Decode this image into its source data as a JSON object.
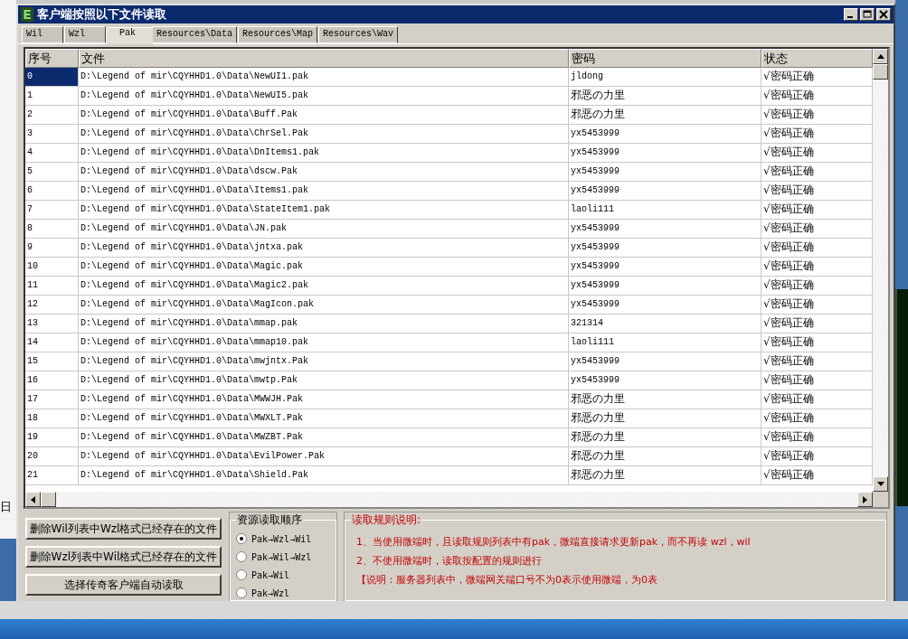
{
  "background": {
    "text": "日"
  },
  "window": {
    "icon_letter": "E",
    "title": "客户端按照以下文件读取"
  },
  "tabs": [
    {
      "label": "Wil",
      "selected": false
    },
    {
      "label": "Wzl",
      "selected": false
    },
    {
      "label": "Pak",
      "selected": true
    },
    {
      "label": "Resources\\Data",
      "selected": false
    },
    {
      "label": "Resources\\Map",
      "selected": false
    },
    {
      "label": "Resources\\Wav",
      "selected": false
    }
  ],
  "table": {
    "columns": [
      "序号",
      "文件",
      "密码",
      "状态"
    ],
    "rows": [
      {
        "cells": [
          "0",
          "D:\\Legend of mir\\CQYHHD1.0\\Data\\NewUI1.pak",
          "jldong",
          "√密码正确"
        ],
        "selected": true
      },
      {
        "cells": [
          "1",
          "D:\\Legend of mir\\CQYHHD1.0\\Data\\NewUI5.pak",
          "邪恶の力里",
          "√密码正确"
        ],
        "selected": false
      },
      {
        "cells": [
          "2",
          "D:\\Legend of mir\\CQYHHD1.0\\Data\\Buff.Pak",
          "邪恶の力里",
          "√密码正确"
        ],
        "selected": false
      },
      {
        "cells": [
          "3",
          "D:\\Legend of mir\\CQYHHD1.0\\Data\\ChrSel.Pak",
          "yx5453999",
          "√密码正确"
        ],
        "selected": false
      },
      {
        "cells": [
          "4",
          "D:\\Legend of mir\\CQYHHD1.0\\Data\\DnItems1.pak",
          "yx5453999",
          "√密码正确"
        ],
        "selected": false
      },
      {
        "cells": [
          "5",
          "D:\\Legend of mir\\CQYHHD1.0\\Data\\dscw.Pak",
          "yx5453999",
          "√密码正确"
        ],
        "selected": false
      },
      {
        "cells": [
          "6",
          "D:\\Legend of mir\\CQYHHD1.0\\Data\\Items1.pak",
          "yx5453999",
          "√密码正确"
        ],
        "selected": false
      },
      {
        "cells": [
          "7",
          "D:\\Legend of mir\\CQYHHD1.0\\Data\\StateItem1.pak",
          "laoli111",
          "√密码正确"
        ],
        "selected": false
      },
      {
        "cells": [
          "8",
          "D:\\Legend of mir\\CQYHHD1.0\\Data\\JN.pak",
          "yx5453999",
          "√密码正确"
        ],
        "selected": false
      },
      {
        "cells": [
          "9",
          "D:\\Legend of mir\\CQYHHD1.0\\Data\\jntxa.pak",
          "yx5453999",
          "√密码正确"
        ],
        "selected": false
      },
      {
        "cells": [
          "10",
          "D:\\Legend of mir\\CQYHHD1.0\\Data\\Magic.pak",
          "yx5453999",
          "√密码正确"
        ],
        "selected": false
      },
      {
        "cells": [
          "11",
          "D:\\Legend of mir\\CQYHHD1.0\\Data\\Magic2.pak",
          "yx5453999",
          "√密码正确"
        ],
        "selected": false
      },
      {
        "cells": [
          "12",
          "D:\\Legend of mir\\CQYHHD1.0\\Data\\MagIcon.pak",
          "yx5453999",
          "√密码正确"
        ],
        "selected": false
      },
      {
        "cells": [
          "13",
          "D:\\Legend of mir\\CQYHHD1.0\\Data\\mmap.pak",
          "321314",
          "√密码正确"
        ],
        "selected": false
      },
      {
        "cells": [
          "14",
          "D:\\Legend of mir\\CQYHHD1.0\\Data\\mmap10.pak",
          "laoli111",
          "√密码正确"
        ],
        "selected": false
      },
      {
        "cells": [
          "15",
          "D:\\Legend of mir\\CQYHHD1.0\\Data\\mwjntx.Pak",
          "yx5453999",
          "√密码正确"
        ],
        "selected": false
      },
      {
        "cells": [
          "16",
          "D:\\Legend of mir\\CQYHHD1.0\\Data\\mwtp.Pak",
          "yx5453999",
          "√密码正确"
        ],
        "selected": false
      },
      {
        "cells": [
          "17",
          "D:\\Legend of mir\\CQYHHD1.0\\Data\\MWWJH.Pak",
          "邪恶の力里",
          "√密码正确"
        ],
        "selected": false
      },
      {
        "cells": [
          "18",
          "D:\\Legend of mir\\CQYHHD1.0\\Data\\MWXLT.Pak",
          "邪恶の力里",
          "√密码正确"
        ],
        "selected": false
      },
      {
        "cells": [
          "19",
          "D:\\Legend of mir\\CQYHHD1.0\\Data\\MWZBT.Pak",
          "邪恶の力里",
          "√密码正确"
        ],
        "selected": false
      },
      {
        "cells": [
          "20",
          "D:\\Legend of mir\\CQYHHD1.0\\Data\\EvilPower.Pak",
          "邪恶の力里",
          "√密码正确"
        ],
        "selected": false
      },
      {
        "cells": [
          "21",
          "D:\\Legend of mir\\CQYHHD1.0\\Data\\Shield.Pak",
          "邪恶の力里",
          "√密码正确"
        ],
        "selected": false
      }
    ]
  },
  "buttons": [
    "删除Wil列表中Wzl格式已经存在的文件",
    "删除Wzl列表中Wil格式已经存在的文件",
    "选择传奇客户端自动读取"
  ],
  "order_group": {
    "title": "资源读取顺序",
    "options": [
      {
        "label": "Pak→Wzl→Wil",
        "selected": true
      },
      {
        "label": "Pak→Wil→Wzl",
        "selected": false
      },
      {
        "label": "Pak→Wil",
        "selected": false
      },
      {
        "label": "Pak→Wzl",
        "selected": false
      }
    ]
  },
  "rules_group": {
    "title": "读取规则说明:",
    "lines": [
      "1、当使用微端时，且读取规则列表中有pak，微端直接请求更新pak，而不再读 wzl，wil",
      "2、不使用微端时，读取按配置的规则进行",
      "【说明：服务器列表中，微端网关端口号不为0表示使用微端，为0表"
    ]
  }
}
